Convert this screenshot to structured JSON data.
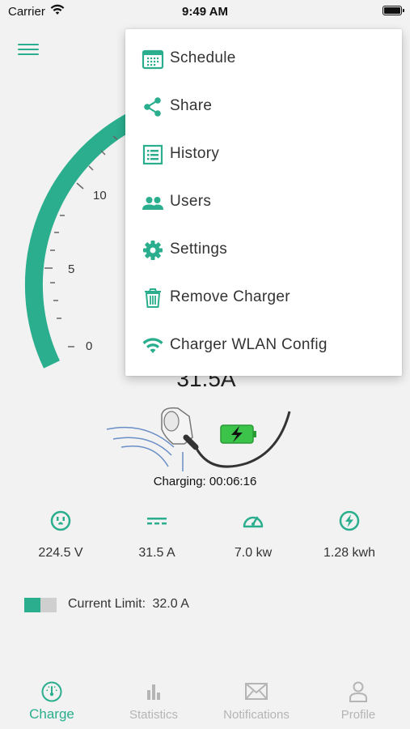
{
  "status_bar": {
    "carrier": "Carrier",
    "time": "9:49 AM"
  },
  "colors": {
    "accent": "#2aae8d",
    "inactive": "#b5b5b5",
    "battery": "#3cc34a"
  },
  "gauge": {
    "ticks": [
      "0",
      "5",
      "10"
    ],
    "current_amps": "31.5A"
  },
  "charging": {
    "label": "Charging: 00:06:16"
  },
  "metrics": [
    {
      "icon": "outlet-icon",
      "value": "224.5 V"
    },
    {
      "icon": "dc-current-icon",
      "value": "31.5 A"
    },
    {
      "icon": "speedometer-icon",
      "value": "7.0 kw"
    },
    {
      "icon": "lightning-icon",
      "value": "1.28 kwh"
    }
  ],
  "current_limit": {
    "label": "Current Limit:",
    "value": "32.0 A",
    "toggle_level": 0.5
  },
  "bottom_nav": [
    {
      "label": "Charge",
      "icon": "gauge-icon",
      "active": true
    },
    {
      "label": "Statistics",
      "icon": "bar-chart-icon",
      "active": false
    },
    {
      "label": "Notifications",
      "icon": "mail-icon",
      "active": false
    },
    {
      "label": "Profile",
      "icon": "person-icon",
      "active": false
    }
  ],
  "dropdown_menu": [
    {
      "label": "Schedule",
      "icon": "calendar-icon"
    },
    {
      "label": "Share",
      "icon": "share-icon"
    },
    {
      "label": "History",
      "icon": "list-icon"
    },
    {
      "label": "Users",
      "icon": "users-icon"
    },
    {
      "label": "Settings",
      "icon": "gear-icon"
    },
    {
      "label": "Remove Charger",
      "icon": "trash-icon"
    },
    {
      "label": "Charger WLAN Config",
      "icon": "wifi-icon"
    }
  ]
}
